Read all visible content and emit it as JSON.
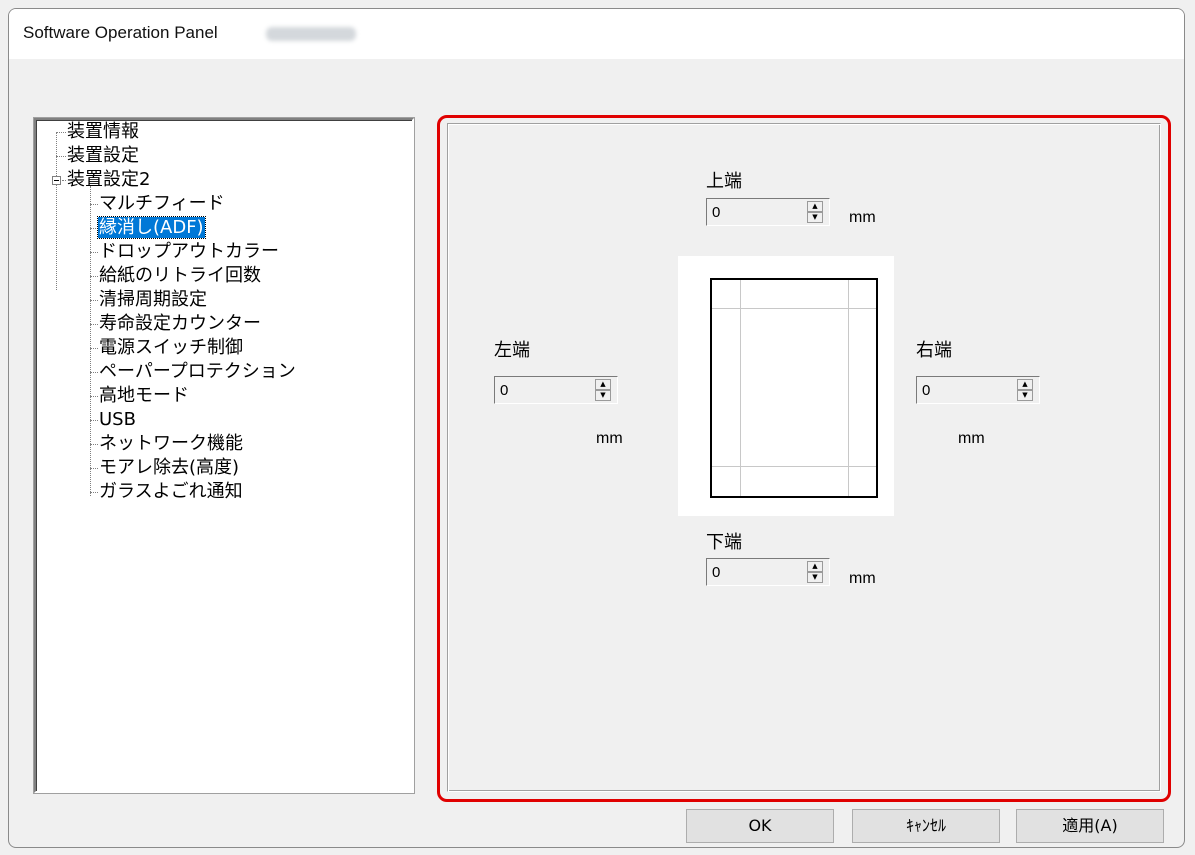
{
  "window": {
    "title": "Software Operation Panel"
  },
  "tree": {
    "items": [
      {
        "label": "装置情報"
      },
      {
        "label": "装置設定"
      },
      {
        "label": "装置設定2"
      },
      {
        "label": "マルチフィード"
      },
      {
        "label": "縁消し(ADF)",
        "selected": true
      },
      {
        "label": "ドロップアウトカラー"
      },
      {
        "label": "給紙のリトライ回数"
      },
      {
        "label": "清掃周期設定"
      },
      {
        "label": "寿命設定カウンター"
      },
      {
        "label": "電源スイッチ制御"
      },
      {
        "label": "ペーパープロテクション"
      },
      {
        "label": "高地モード"
      },
      {
        "label": "USB"
      },
      {
        "label": "ネットワーク機能"
      },
      {
        "label": "モアレ除去(高度)"
      },
      {
        "label": "ガラスよごれ通知"
      }
    ]
  },
  "edge_erase": {
    "top": {
      "label": "上端",
      "value": "0",
      "unit": "mm"
    },
    "left": {
      "label": "左端",
      "value": "0",
      "unit": "mm"
    },
    "right": {
      "label": "右端",
      "value": "0",
      "unit": "mm"
    },
    "bottom": {
      "label": "下端",
      "value": "0",
      "unit": "mm"
    }
  },
  "buttons": {
    "ok": "OK",
    "cancel": "ｷｬﾝｾﾙ",
    "apply": "適用(A)"
  },
  "colors": {
    "highlight_border": "#e00000",
    "selection": "#0078d7"
  }
}
